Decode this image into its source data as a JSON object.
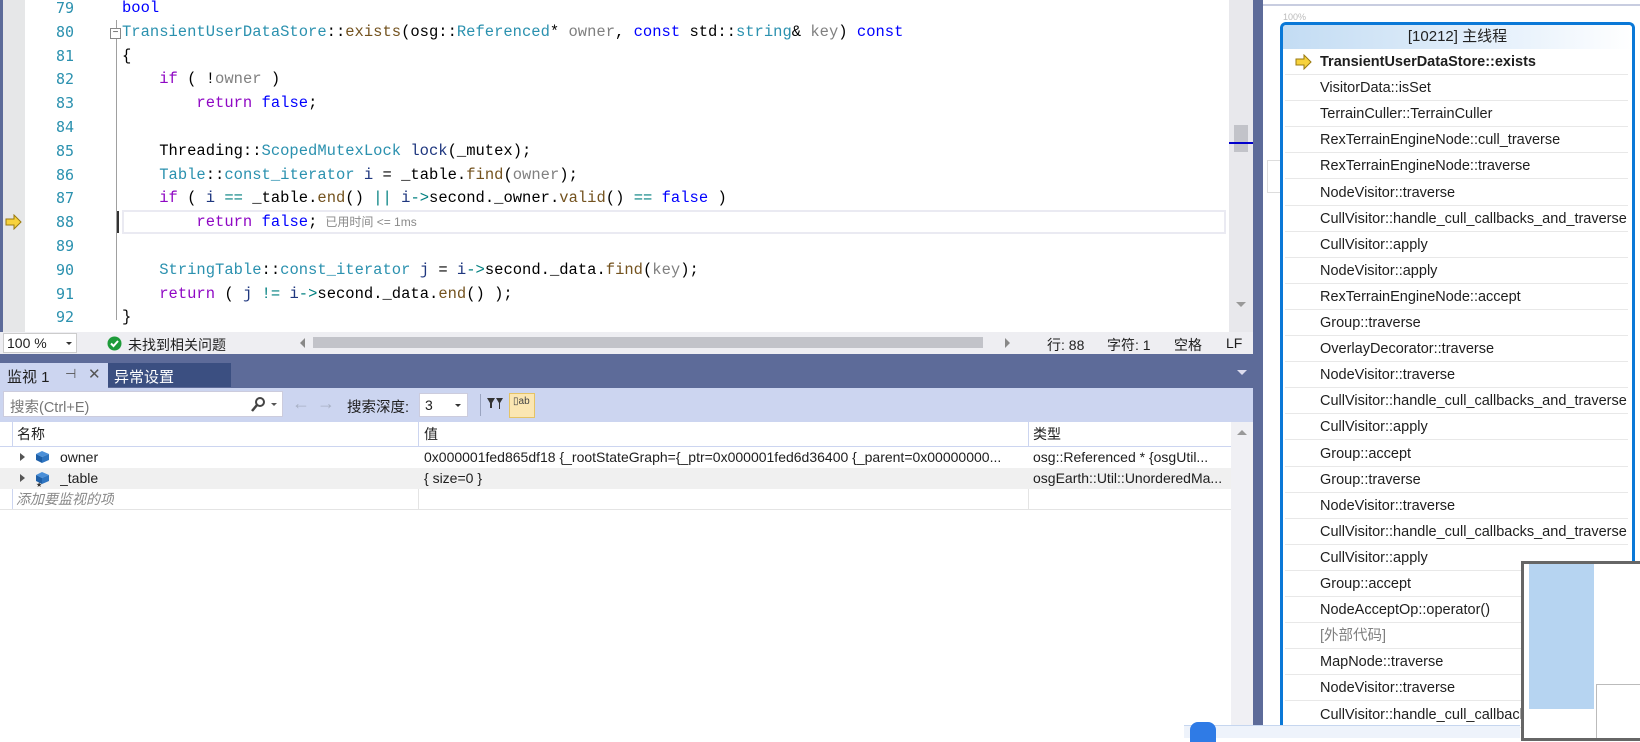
{
  "editor": {
    "lines": [
      {
        "n": "79",
        "tokens": [
          {
            "t": "bool",
            "c": "kw"
          }
        ]
      },
      {
        "n": "80",
        "tokens": [
          {
            "t": "TransientUserDataStore",
            "c": "ty"
          },
          {
            "t": "::",
            "c": "tx"
          },
          {
            "t": "exists",
            "c": "fn"
          },
          {
            "t": "(osg::",
            "c": "tx"
          },
          {
            "t": "Referenced",
            "c": "ty"
          },
          {
            "t": "* ",
            "c": "tx"
          },
          {
            "t": "owner",
            "c": "pa"
          },
          {
            "t": ", ",
            "c": "tx"
          },
          {
            "t": "const",
            "c": "kw"
          },
          {
            "t": " std::",
            "c": "tx"
          },
          {
            "t": "string",
            "c": "ty"
          },
          {
            "t": "& ",
            "c": "tx"
          },
          {
            "t": "key",
            "c": "pa"
          },
          {
            "t": ") ",
            "c": "tx"
          },
          {
            "t": "const",
            "c": "kw"
          }
        ]
      },
      {
        "n": "81",
        "tokens": [
          {
            "t": "{",
            "c": "tx"
          }
        ]
      },
      {
        "n": "82",
        "tokens": [
          {
            "t": "    ",
            "c": "tx"
          },
          {
            "t": "if",
            "c": "ctl"
          },
          {
            "t": " ( !",
            "c": "tx"
          },
          {
            "t": "owner",
            "c": "pa"
          },
          {
            "t": " )",
            "c": "tx"
          }
        ]
      },
      {
        "n": "83",
        "tokens": [
          {
            "t": "        ",
            "c": "tx"
          },
          {
            "t": "return",
            "c": "ctl"
          },
          {
            "t": " ",
            "c": "tx"
          },
          {
            "t": "false",
            "c": "kw"
          },
          {
            "t": ";",
            "c": "tx"
          }
        ]
      },
      {
        "n": "84",
        "tokens": []
      },
      {
        "n": "85",
        "tokens": [
          {
            "t": "    Threading::",
            "c": "tx"
          },
          {
            "t": "ScopedMutexLock",
            "c": "ty"
          },
          {
            "t": " ",
            "c": "tx"
          },
          {
            "t": "lock",
            "c": "va"
          },
          {
            "t": "(_mutex);",
            "c": "tx"
          }
        ]
      },
      {
        "n": "86",
        "tokens": [
          {
            "t": "    ",
            "c": "tx"
          },
          {
            "t": "Table",
            "c": "ty"
          },
          {
            "t": "::",
            "c": "tx"
          },
          {
            "t": "const_iterator",
            "c": "ty"
          },
          {
            "t": " ",
            "c": "tx"
          },
          {
            "t": "i",
            "c": "va"
          },
          {
            "t": " = _table.",
            "c": "tx"
          },
          {
            "t": "find",
            "c": "fn"
          },
          {
            "t": "(",
            "c": "tx"
          },
          {
            "t": "owner",
            "c": "pa"
          },
          {
            "t": ");",
            "c": "tx"
          }
        ]
      },
      {
        "n": "87",
        "tokens": [
          {
            "t": "    ",
            "c": "tx"
          },
          {
            "t": "if",
            "c": "ctl"
          },
          {
            "t": " ( ",
            "c": "tx"
          },
          {
            "t": "i",
            "c": "va"
          },
          {
            "t": " == ",
            "c": "op"
          },
          {
            "t": "_table.",
            "c": "tx"
          },
          {
            "t": "end",
            "c": "fn"
          },
          {
            "t": "() ",
            "c": "tx"
          },
          {
            "t": "||",
            "c": "op"
          },
          {
            "t": " ",
            "c": "tx"
          },
          {
            "t": "i",
            "c": "va"
          },
          {
            "t": "->",
            "c": "op"
          },
          {
            "t": "second._owner.",
            "c": "tx"
          },
          {
            "t": "valid",
            "c": "fn"
          },
          {
            "t": "() ",
            "c": "tx"
          },
          {
            "t": "==",
            "c": "op"
          },
          {
            "t": " ",
            "c": "tx"
          },
          {
            "t": "false",
            "c": "kw"
          },
          {
            "t": " )",
            "c": "tx"
          }
        ]
      },
      {
        "n": "88",
        "tokens": [
          {
            "t": "        ",
            "c": "tx"
          },
          {
            "t": "return",
            "c": "ctl"
          },
          {
            "t": " ",
            "c": "tx"
          },
          {
            "t": "false",
            "c": "kw"
          },
          {
            "t": ";",
            "c": "tx"
          }
        ],
        "hint": "已用时间 <= 1ms"
      },
      {
        "n": "89",
        "tokens": []
      },
      {
        "n": "90",
        "tokens": [
          {
            "t": "    ",
            "c": "tx"
          },
          {
            "t": "StringTable",
            "c": "ty"
          },
          {
            "t": "::",
            "c": "tx"
          },
          {
            "t": "const_iterator",
            "c": "ty"
          },
          {
            "t": " ",
            "c": "tx"
          },
          {
            "t": "j",
            "c": "va"
          },
          {
            "t": " = ",
            "c": "tx"
          },
          {
            "t": "i",
            "c": "va"
          },
          {
            "t": "->",
            "c": "op"
          },
          {
            "t": "second._data.",
            "c": "tx"
          },
          {
            "t": "find",
            "c": "fn"
          },
          {
            "t": "(",
            "c": "tx"
          },
          {
            "t": "key",
            "c": "pa"
          },
          {
            "t": ");",
            "c": "tx"
          }
        ]
      },
      {
        "n": "91",
        "tokens": [
          {
            "t": "    ",
            "c": "tx"
          },
          {
            "t": "return",
            "c": "ctl"
          },
          {
            "t": " ( ",
            "c": "tx"
          },
          {
            "t": "j",
            "c": "va"
          },
          {
            "t": " != ",
            "c": "op"
          },
          {
            "t": "i",
            "c": "va"
          },
          {
            "t": "->",
            "c": "op"
          },
          {
            "t": "second._data.",
            "c": "tx"
          },
          {
            "t": "end",
            "c": "fn"
          },
          {
            "t": "() );",
            "c": "tx"
          }
        ]
      },
      {
        "n": "92",
        "tokens": [
          {
            "t": "}",
            "c": "tx"
          }
        ]
      }
    ]
  },
  "status": {
    "zoom": "100 %",
    "issues": "未找到相关问题",
    "line": "行: 88",
    "char": "字符: 1",
    "whitespace": "空格",
    "eol": "LF"
  },
  "watch": {
    "tabs": [
      {
        "label": "监视 1",
        "active": true
      },
      {
        "label": "异常设置",
        "active": false
      }
    ],
    "search_placeholder": "搜索(Ctrl+E)",
    "depth_label": "搜索深度:",
    "depth_value": "3",
    "columns": [
      "名称",
      "值",
      "类型"
    ],
    "rows": [
      {
        "name": "owner",
        "value": "0x000001fed865df18 {_rootStateGraph={_ptr=0x000001fed6d36400 {_parent=0x00000000...",
        "type": "osg::Referenced * {osgUtil..."
      },
      {
        "name": "_table",
        "value": "{ size=0 }",
        "type": "osgEarth::Util::UnorderedMa..."
      }
    ],
    "add_item": "添加要监视的项"
  },
  "callstack": {
    "title": "[10212] 主线程",
    "zoom_label": "100%",
    "frames": [
      {
        "label": "TransientUserDataStore::exists",
        "current": true
      },
      {
        "label": "VisitorData::isSet"
      },
      {
        "label": "TerrainCuller::TerrainCuller"
      },
      {
        "label": "RexTerrainEngineNode::cull_traverse"
      },
      {
        "label": "RexTerrainEngineNode::traverse"
      },
      {
        "label": "NodeVisitor::traverse"
      },
      {
        "label": "CullVisitor::handle_cull_callbacks_and_traverse"
      },
      {
        "label": "CullVisitor::apply"
      },
      {
        "label": "NodeVisitor::apply"
      },
      {
        "label": "RexTerrainEngineNode::accept"
      },
      {
        "label": "Group::traverse"
      },
      {
        "label": "OverlayDecorator::traverse"
      },
      {
        "label": "NodeVisitor::traverse"
      },
      {
        "label": "CullVisitor::handle_cull_callbacks_and_traverse"
      },
      {
        "label": "CullVisitor::apply"
      },
      {
        "label": "Group::accept"
      },
      {
        "label": "Group::traverse"
      },
      {
        "label": "NodeVisitor::traverse"
      },
      {
        "label": "CullVisitor::handle_cull_callbacks_and_traverse"
      },
      {
        "label": "CullVisitor::apply"
      },
      {
        "label": "Group::accept"
      },
      {
        "label": "NodeAcceptOp::operator()"
      },
      {
        "label": "[外部代码]",
        "external": true
      },
      {
        "label": "MapNode::traverse"
      },
      {
        "label": "NodeVisitor::traverse"
      },
      {
        "label": "CullVisitor::handle_cull_callbacks_and_traverse"
      }
    ]
  },
  "colors": {
    "accent": "#0a78d7",
    "tab_band": "#5d6b99",
    "toolbar": "#ccd5f0",
    "line_number": "#2b91af"
  }
}
